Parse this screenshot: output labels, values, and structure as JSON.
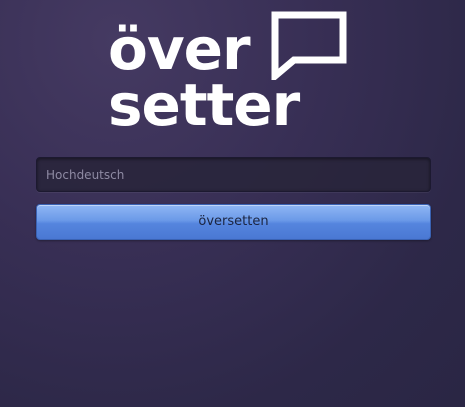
{
  "logo": {
    "line1": "över",
    "line2": "setter",
    "icon": "speech-bubble-icon"
  },
  "form": {
    "input": {
      "placeholder": "Hochdeutsch",
      "value": ""
    },
    "submit_label": "översetten"
  },
  "colors": {
    "background": "#332d50",
    "button": "#5b8be0",
    "logo": "#ffffff"
  }
}
